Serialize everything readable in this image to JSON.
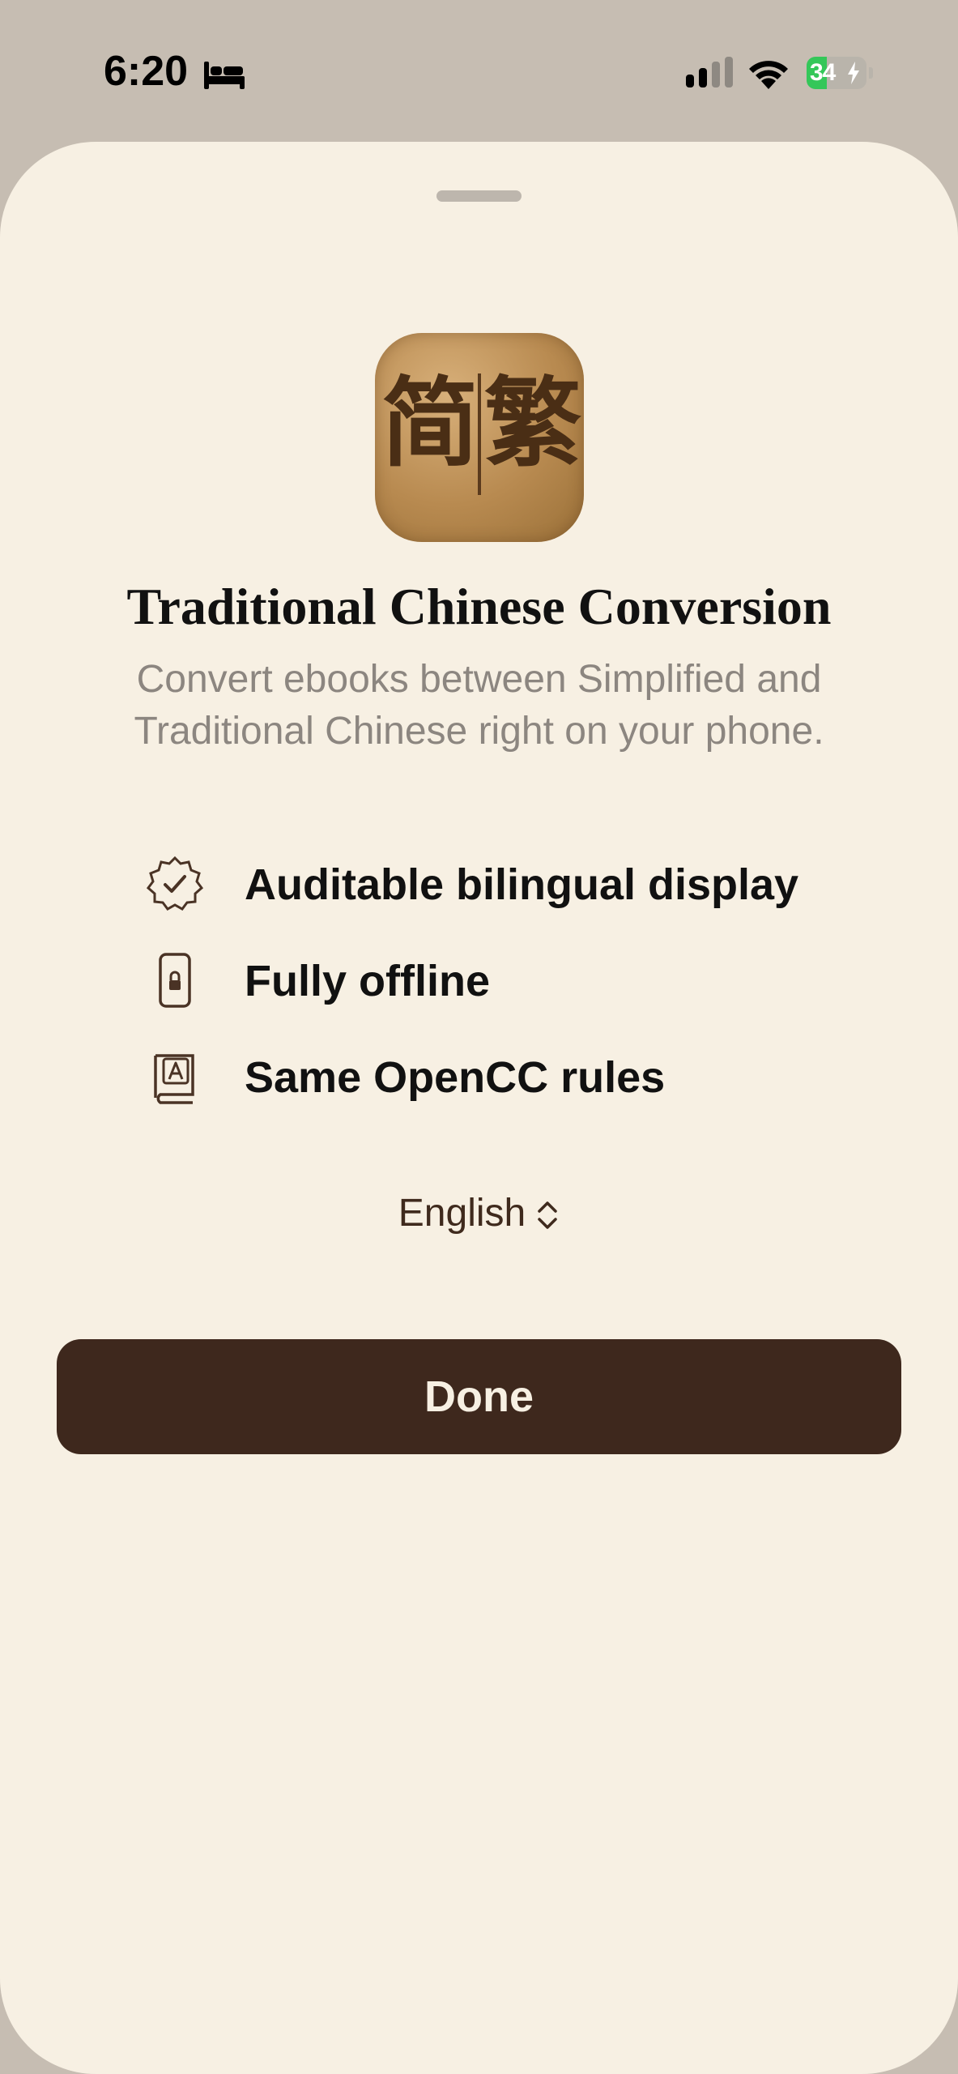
{
  "status_bar": {
    "time": "6:20",
    "battery": "34",
    "battery_level": 0.34,
    "icons": [
      "bed-icon",
      "cellular-signal-icon",
      "wifi-icon",
      "battery-charging-icon"
    ]
  },
  "sheet": {
    "app_icon": {
      "left_char": "简",
      "right_char": "繁"
    },
    "title": "Traditional Chinese Conversion",
    "subtitle": "Convert ebooks between Simplified and Traditional Chinese right on your phone.",
    "features": [
      {
        "icon": "verified-badge-icon",
        "label": "Auditable bilingual display"
      },
      {
        "icon": "phone-lock-icon",
        "label": "Fully offline"
      },
      {
        "icon": "dictionary-book-icon",
        "label": "Same OpenCC rules"
      }
    ],
    "language": {
      "selected": "English",
      "icon": "chevron-up-down-icon"
    },
    "done_label": "Done"
  },
  "colors": {
    "sheet_background": "#f7f0e3",
    "page_background": "#c6bdb2",
    "accent_brown": "#3e281d",
    "subtitle_gray": "#8c8680",
    "battery_green": "#34c759"
  }
}
